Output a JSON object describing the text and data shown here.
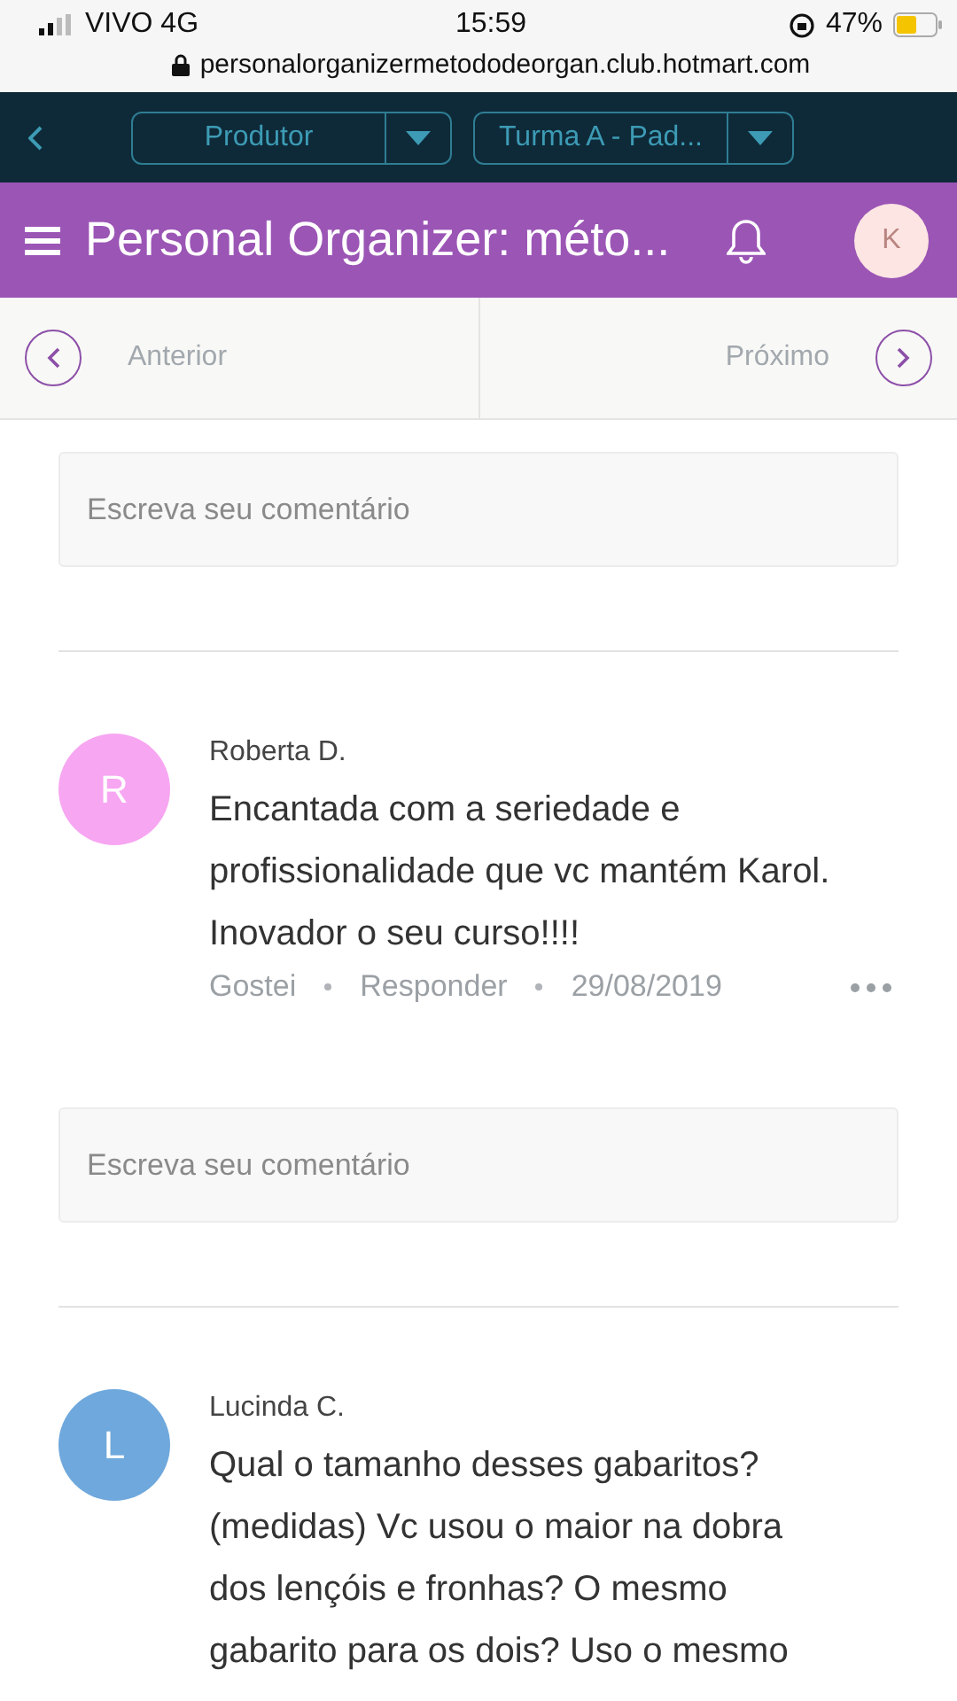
{
  "status_bar": {
    "carrier": "VIVO 4G",
    "time": "15:59",
    "battery": "47%",
    "url": "personalorganizermetododeorgan.club.hotmart.com"
  },
  "top_bar": {
    "dropdowns": [
      {
        "label": "Produtor"
      },
      {
        "label": "Turma A - Pad..."
      }
    ]
  },
  "header": {
    "title": "Personal Organizer: méto...",
    "avatar": "K"
  },
  "lesson_nav": {
    "previous": "Anterior",
    "next": "Próximo"
  },
  "feed": [
    {
      "kind": "comment_field",
      "placeholder": "Escreva seu comentário"
    },
    {
      "kind": "comment",
      "author": "Roberta D.",
      "avatar": "R",
      "color": "#f7a6f2",
      "text": "Encantada com a seriedade e profissionalidade que vc mantém Karol. Inovador o seu curso!!!!",
      "like": "Gostei",
      "reply": "Responder",
      "date": "29/08/2019"
    },
    {
      "kind": "comment_field",
      "placeholder": "Escreva seu comentário"
    },
    {
      "kind": "comment",
      "author": "Lucinda C.",
      "avatar": "L",
      "color": "#6fa8dc",
      "text": "Qual o tamanho desses gabaritos? (medidas) Vc usou o maior na dobra dos lençóis e fronhas? O mesmo gabarito para os dois? Uso o mesmo"
    }
  ]
}
